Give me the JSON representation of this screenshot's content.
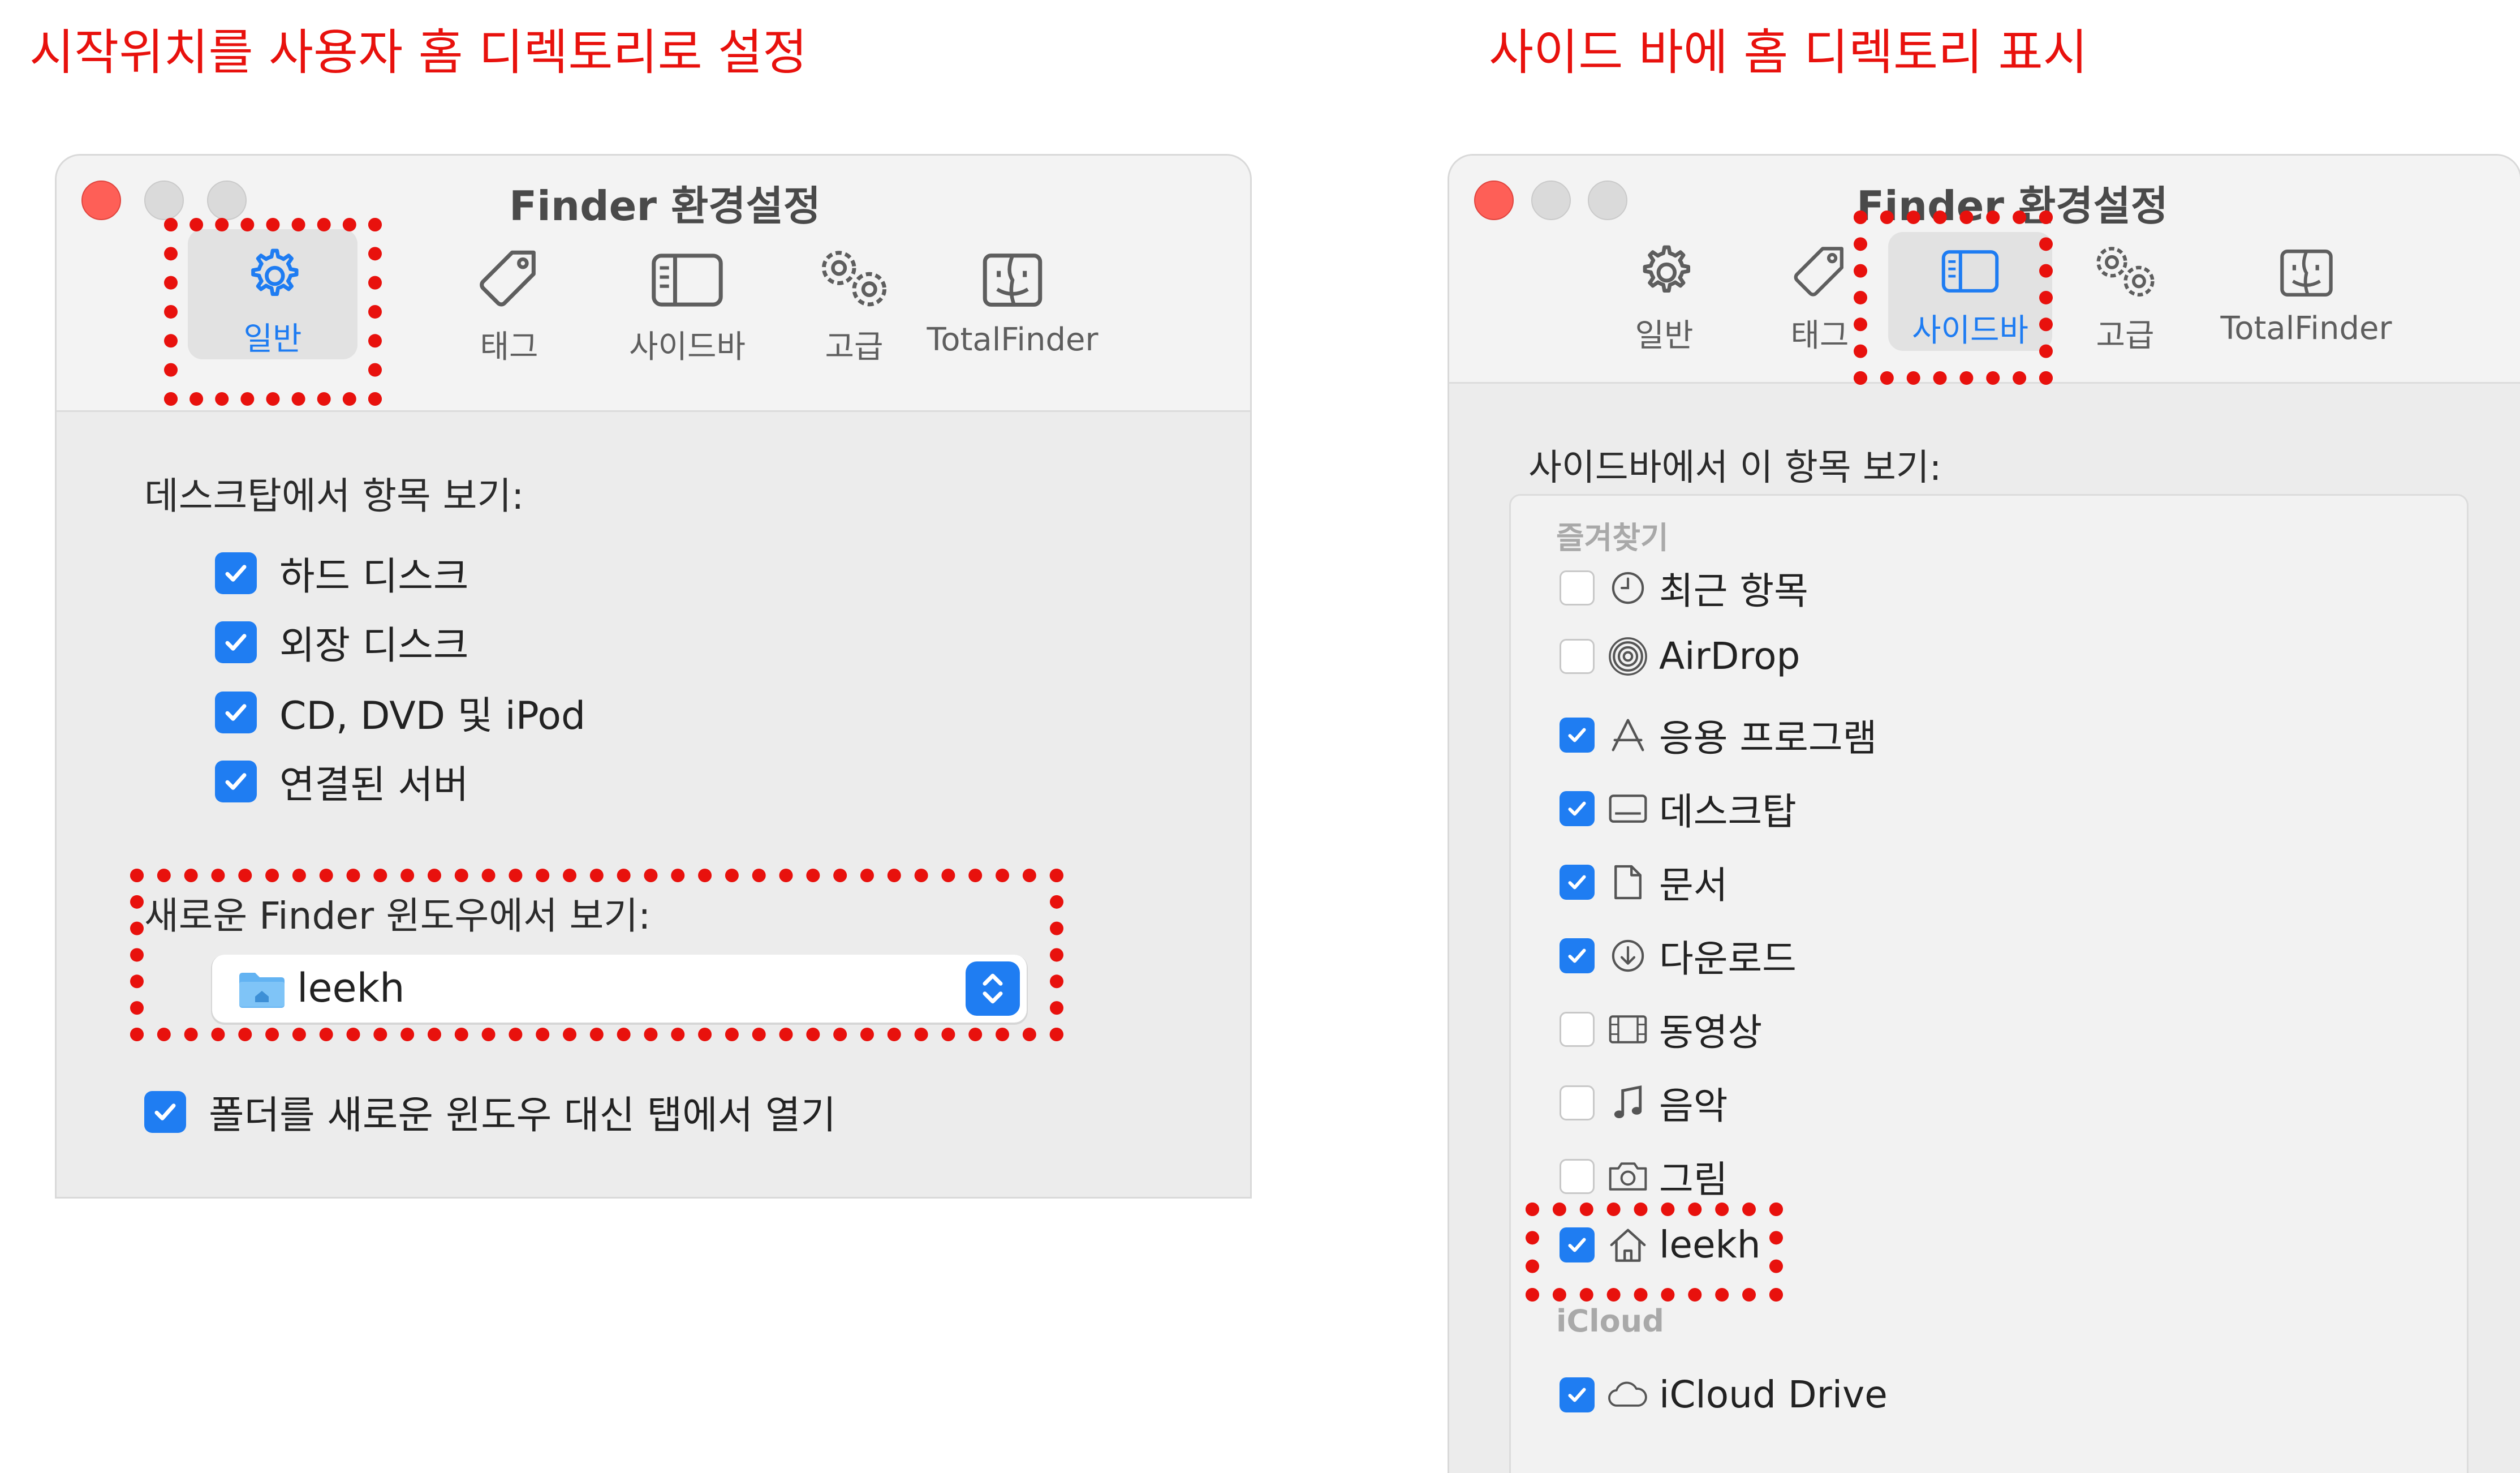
{
  "captions": {
    "left": "시작위치를 사용자 홈 디렉토리로 설정",
    "right": "사이드 바에 홈 디렉토리 표시"
  },
  "left_window": {
    "title": "Finder 환경설정",
    "tabs": [
      {
        "label": "일반",
        "icon": "gear-icon",
        "selected": true
      },
      {
        "label": "태그",
        "icon": "tag-icon",
        "selected": false
      },
      {
        "label": "사이드바",
        "icon": "sidebar-icon",
        "selected": false
      },
      {
        "label": "고급",
        "icon": "advanced-gears-icon",
        "selected": false
      },
      {
        "label": "TotalFinder",
        "icon": "totalfinder-icon",
        "selected": false
      }
    ],
    "desktop_section_label": "데스크탑에서 항목 보기:",
    "desktop_items": [
      {
        "label": "하드 디스크",
        "checked": true
      },
      {
        "label": "외장 디스크",
        "checked": true
      },
      {
        "label": "CD, DVD 및 iPod",
        "checked": true
      },
      {
        "label": "연결된 서버",
        "checked": true
      }
    ],
    "new_window_label": "새로운 Finder 윈도우에서 보기:",
    "new_window_value": "leekh",
    "open_tabs": {
      "label": "폴더를 새로운 윈도우 대신 탭에서 열기",
      "checked": true
    }
  },
  "right_window": {
    "title": "Finder 환경설정",
    "tabs": [
      {
        "label": "일반",
        "icon": "gear-icon",
        "selected": false
      },
      {
        "label": "태그",
        "icon": "tag-icon",
        "selected": false
      },
      {
        "label": "사이드바",
        "icon": "sidebar-icon",
        "selected": true
      },
      {
        "label": "고급",
        "icon": "advanced-gears-icon",
        "selected": false
      },
      {
        "label": "TotalFinder",
        "icon": "totalfinder-icon",
        "selected": false
      }
    ],
    "section_label": "사이드바에서 이 항목 보기:",
    "favorites_header": "즐겨찾기",
    "favorites": [
      {
        "label": "최근 항목",
        "icon": "clock-icon",
        "checked": false
      },
      {
        "label": "AirDrop",
        "icon": "airdrop-icon",
        "checked": false
      },
      {
        "label": "응용 프로그램",
        "icon": "applications-icon",
        "checked": true
      },
      {
        "label": "데스크탑",
        "icon": "desktop-icon",
        "checked": true
      },
      {
        "label": "문서",
        "icon": "document-icon",
        "checked": true
      },
      {
        "label": "다운로드",
        "icon": "download-icon",
        "checked": true
      },
      {
        "label": "동영상",
        "icon": "film-icon",
        "checked": false
      },
      {
        "label": "음악",
        "icon": "music-icon",
        "checked": false
      },
      {
        "label": "그림",
        "icon": "camera-icon",
        "checked": false
      },
      {
        "label": "leekh",
        "icon": "home-icon",
        "checked": true
      }
    ],
    "icloud_header": "iCloud",
    "icloud_items": [
      {
        "label": "iCloud Drive",
        "icon": "cloud-icon",
        "checked": true
      }
    ]
  },
  "colors": {
    "annotation_red": "#e8110d",
    "accent_blue": "#1f7df2",
    "close_red": "#fe5f57"
  }
}
